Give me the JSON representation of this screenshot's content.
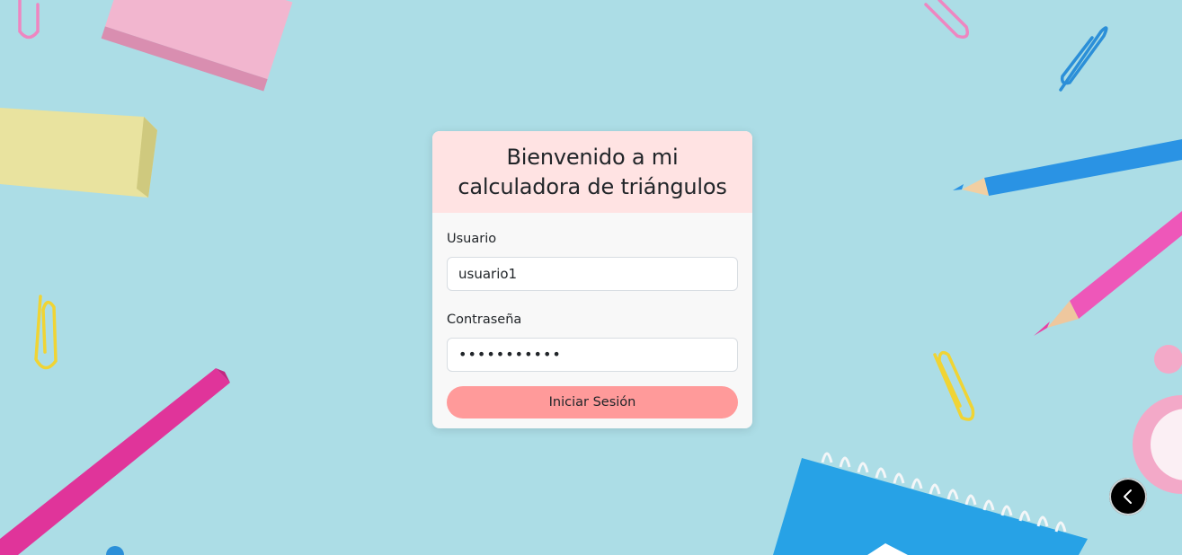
{
  "login": {
    "title": "Bienvenido a mi calculadora de triángulos",
    "username_label": "Usuario",
    "username_value": "usuario1",
    "password_label": "Contraseña",
    "password_value": "•••••••••••",
    "submit_label": "Iniciar Sesión"
  },
  "icons": {
    "back": "chevron-left-icon"
  },
  "colors": {
    "background": "#a9dbe5",
    "header": "#ffe3e3",
    "button": "#ff9a9a"
  }
}
